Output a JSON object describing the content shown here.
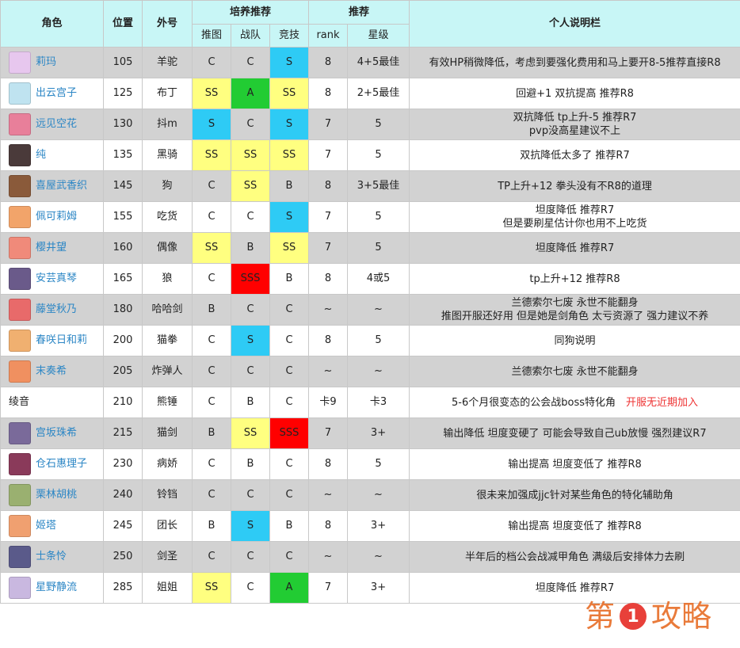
{
  "header": {
    "role": "角色",
    "position": "位置",
    "nickname": "外号",
    "training": "培养推荐",
    "recommend": "推荐",
    "note": "个人说明栏",
    "sub": [
      "推图",
      "战队",
      "竞技",
      "rank",
      "星级"
    ]
  },
  "grade_colors": {
    "S": "#2ecbf5",
    "SS": "#ffff80",
    "SSS": "#ff0000",
    "A": "#22cc33"
  },
  "rows": [
    {
      "name": "莉玛",
      "pos": "105",
      "nick": "羊驼",
      "push": "C",
      "clan": "C",
      "arena": "S",
      "rank": "8",
      "star": "4+5最佳",
      "note1": "有效HP稍微降低，考虑到要强化费用和马上要开8-5推荐直接R8",
      "note2": "",
      "note_red": "",
      "avatar": "#e7c7ee",
      "link": true
    },
    {
      "name": "出云宫子",
      "pos": "125",
      "nick": "布丁",
      "push": "SS",
      "clan": "A",
      "arena": "SS",
      "rank": "8",
      "star": "2+5最佳",
      "note1": "回避+1 双抗提高 推荐R8",
      "note2": "",
      "note_red": "",
      "avatar": "#bfe3f0",
      "link": true
    },
    {
      "name": "远见空花",
      "pos": "130",
      "nick": "抖m",
      "push": "S",
      "clan": "C",
      "arena": "S",
      "rank": "7",
      "star": "5",
      "note1": "双抗降低 tp上升-5 推荐R7",
      "note2": "pvp没高星建议不上",
      "note_red": "",
      "avatar": "#e87f9a",
      "link": true
    },
    {
      "name": "纯",
      "pos": "135",
      "nick": "黑骑",
      "push": "SS",
      "clan": "SS",
      "arena": "SS",
      "rank": "7",
      "star": "5",
      "note1": "双抗降低太多了 推荐R7",
      "note2": "",
      "note_red": "",
      "avatar": "#4a3a3a",
      "link": true
    },
    {
      "name": "喜屋武香织",
      "pos": "145",
      "nick": "狗",
      "push": "C",
      "clan": "SS",
      "arena": "B",
      "rank": "8",
      "star": "3+5最佳",
      "note1": "TP上升+12 拳头没有不R8的道理",
      "note2": "",
      "note_red": "",
      "avatar": "#8a5a3a",
      "link": true
    },
    {
      "name": "佩可莉姆",
      "pos": "155",
      "nick": "吃货",
      "push": "C",
      "clan": "C",
      "arena": "S",
      "rank": "7",
      "star": "5",
      "note1": "坦度降低 推荐R7",
      "note2": "但是要刷星估计你也用不上吃货",
      "note_red": "",
      "avatar": "#f2a46a",
      "link": true
    },
    {
      "name": "樱井望",
      "pos": "160",
      "nick": "偶像",
      "push": "SS",
      "clan": "B",
      "arena": "SS",
      "rank": "7",
      "star": "5",
      "note1": "坦度降低 推荐R7",
      "note2": "",
      "note_red": "",
      "avatar": "#f08a7a",
      "link": true
    },
    {
      "name": "安芸真琴",
      "pos": "165",
      "nick": "狼",
      "push": "C",
      "clan": "SSS",
      "arena": "B",
      "rank": "8",
      "star": "4或5",
      "note1": "tp上升+12 推荐R8",
      "note2": "",
      "note_red": "",
      "avatar": "#6a5a8a",
      "link": true
    },
    {
      "name": "藤堂秋乃",
      "pos": "180",
      "nick": "哈哈剑",
      "push": "B",
      "clan": "C",
      "arena": "C",
      "rank": "~",
      "star": "~",
      "note1": "兰德索尔七废 永世不能翻身",
      "note2": "推图开服还好用 但是她是剑角色 太亏资源了 强力建议不养",
      "note_red": "",
      "avatar": "#e86a6a",
      "link": true
    },
    {
      "name": "春咲日和莉",
      "pos": "200",
      "nick": "猫拳",
      "push": "C",
      "clan": "S",
      "arena": "C",
      "rank": "8",
      "star": "5",
      "note1": "同狗说明",
      "note2": "",
      "note_red": "",
      "avatar": "#f0b070",
      "link": true
    },
    {
      "name": "末奏希",
      "pos": "205",
      "nick": "炸弹人",
      "push": "C",
      "clan": "C",
      "arena": "C",
      "rank": "~",
      "star": "~",
      "note1": "兰德索尔七废 永世不能翻身",
      "note2": "",
      "note_red": "",
      "avatar": "#f09060",
      "link": true
    },
    {
      "name": "绫音",
      "pos": "210",
      "nick": "熊锤",
      "push": "C",
      "clan": "B",
      "arena": "C",
      "rank": "卡9",
      "star": "卡3",
      "note1": "5-6个月很变态的公会战boss特化角",
      "note2": "",
      "note_red": "开服无近期加入",
      "avatar": "",
      "link": false
    },
    {
      "name": "宫坂珠希",
      "pos": "215",
      "nick": "猫剑",
      "push": "B",
      "clan": "SS",
      "arena": "SSS",
      "rank": "7",
      "star": "3+",
      "note1": "输出降低 坦度变硬了 可能会导致自己ub放慢 强烈建议R7",
      "note2": "",
      "note_red": "",
      "avatar": "#7a6a9a",
      "link": true
    },
    {
      "name": "仓石惠理子",
      "pos": "230",
      "nick": "病娇",
      "push": "C",
      "clan": "B",
      "arena": "C",
      "rank": "8",
      "star": "5",
      "note1": "输出提高 坦度变低了 推荐R8",
      "note2": "",
      "note_red": "",
      "avatar": "#8a3a5a",
      "link": true
    },
    {
      "name": "栗林胡桃",
      "pos": "240",
      "nick": "铃铛",
      "push": "C",
      "clan": "C",
      "arena": "C",
      "rank": "~",
      "star": "~",
      "note1": "很未来加强成jjc针对某些角色的特化辅助角",
      "note2": "",
      "note_red": "",
      "avatar": "#9ab070",
      "link": true
    },
    {
      "name": "姬塔",
      "pos": "245",
      "nick": "团长",
      "push": "B",
      "clan": "S",
      "arena": "B",
      "rank": "8",
      "star": "3+",
      "note1": "输出提高 坦度变低了 推荐R8",
      "note2": "",
      "note_red": "",
      "avatar": "#f0a070",
      "link": true
    },
    {
      "name": "士条怜",
      "pos": "250",
      "nick": "剑圣",
      "push": "C",
      "clan": "C",
      "arena": "C",
      "rank": "~",
      "star": "~",
      "note1": "半年后的档公会战减甲角色 满级后安排体力去刷",
      "note2": "",
      "note_red": "",
      "avatar": "#5a5a8a",
      "link": true
    },
    {
      "name": "星野静流",
      "pos": "285",
      "nick": "姐姐",
      "push": "SS",
      "clan": "C",
      "arena": "A",
      "rank": "7",
      "star": "3+",
      "note1": "坦度降低 推荐R7",
      "note2": "",
      "note_red": "",
      "avatar": "#c9b8e0",
      "link": true
    }
  ],
  "watermark": {
    "left": "第",
    "num": "1",
    "right": "攻略"
  }
}
